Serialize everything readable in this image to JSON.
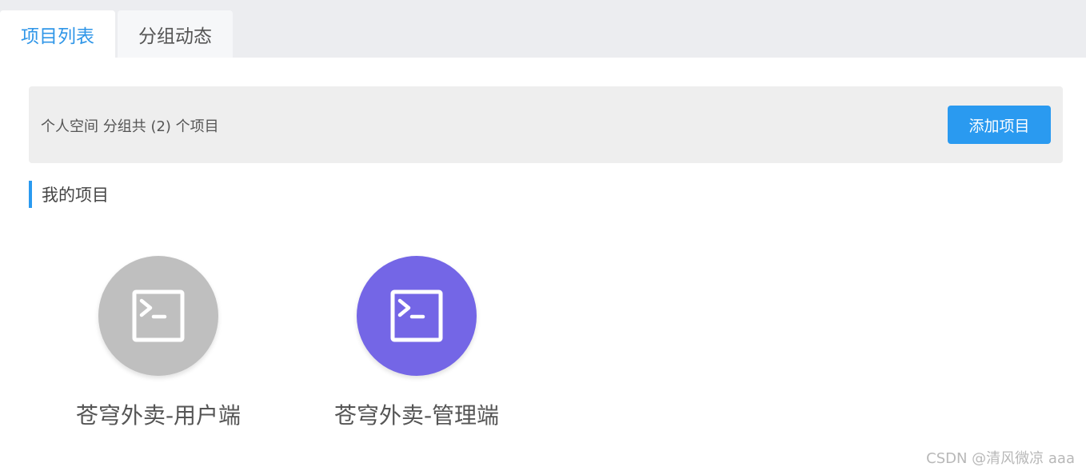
{
  "tabs": {
    "active": "项目列表",
    "inactive": "分组动态"
  },
  "infobar": {
    "text": "个人空间 分组共 (2) 个项目",
    "add_button": "添加项目"
  },
  "section": {
    "title": "我的项目"
  },
  "projects": [
    {
      "name": "苍穹外卖-用户端",
      "icon": "terminal-icon",
      "color": "#bfbfbf"
    },
    {
      "name": "苍穹外卖-管理端",
      "icon": "terminal-icon",
      "color": "#7466e6"
    }
  ],
  "watermark": "CSDN @清风微凉 aaa",
  "colors": {
    "accent": "#2a9af0",
    "tab_active_text": "#2f96e8"
  }
}
